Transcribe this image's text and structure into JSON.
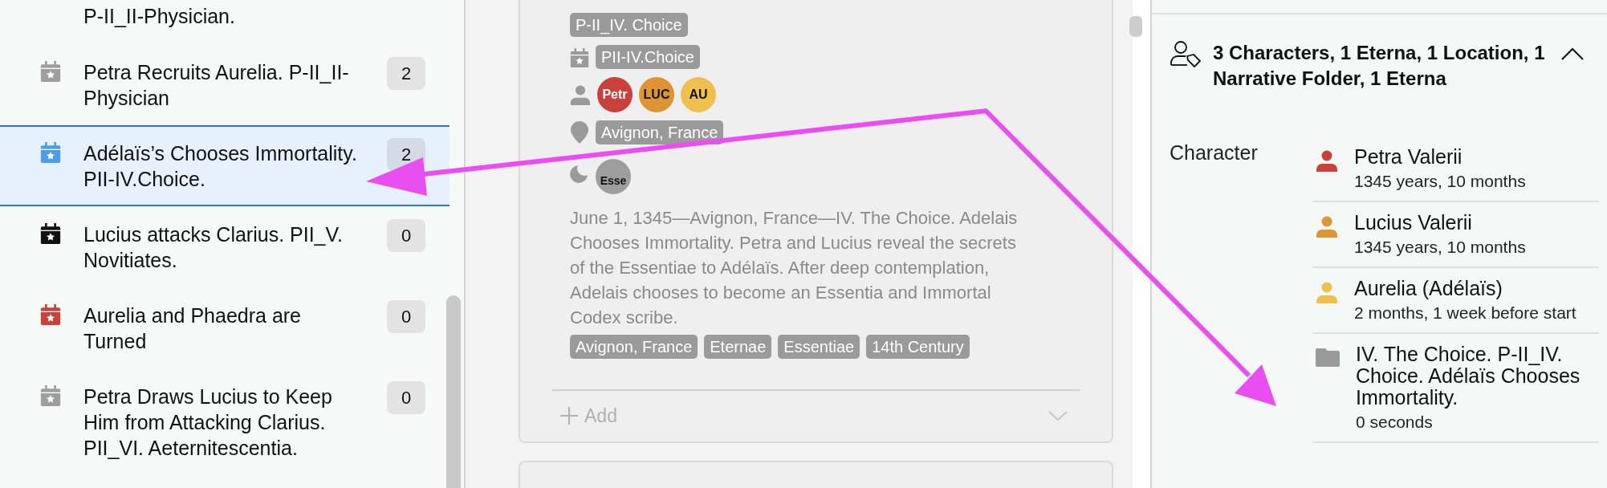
{
  "event_list": {
    "items": [
      {
        "title": "P-II_II-Physician.",
        "kind": "partial"
      },
      {
        "title": "Petra Recruits Aurelia. P-II_II-Physician",
        "count": "2",
        "color": "#9e9e9e",
        "selected": false,
        "kind": "event"
      },
      {
        "title": "Adélaïs’s Chooses Immortality. PII-IV.Choice.",
        "count": "2",
        "color": "#4a9ee8",
        "selected": true,
        "kind": "event"
      },
      {
        "title": "Lucius attacks Clarius. PII_V. Novitiates.",
        "count": "0",
        "color": "#111111",
        "selected": false,
        "kind": "event"
      },
      {
        "title": "Aurelia and Phaedra are Turned",
        "count": "0",
        "color": "#c9413a",
        "selected": false,
        "kind": "event"
      },
      {
        "title": "Petra Draws Lucius to Keep Him from Attacking Clarius. PII_VI. Aeternitescentia.",
        "count": "0",
        "color": "#9e9e9e",
        "selected": false,
        "kind": "event"
      }
    ]
  },
  "event_card": {
    "folder_tag": "P-II_IV. Choice",
    "event_tag": "PII-IV.Choice",
    "characters": [
      {
        "initials": "Petr",
        "color": "#c9413a"
      },
      {
        "initials": "LUC",
        "color": "#dd9432"
      },
      {
        "initials": "AU",
        "color": "#f0c04e"
      }
    ],
    "location_tag": "Avignon, France",
    "eternas": [
      {
        "initials": "Esse",
        "color": "#9e9e9e"
      }
    ],
    "description": "June 1, 1345—Avignon, France—IV. The Choice. Adelais Chooses Immortality. Petra and Lucius reveal the secrets of the Essentiae to Adélaïs. After deep contemplation, Adelais chooses to become an Essentia and Immortal Codex scribe.",
    "tags": [
      "Avignon, France",
      "Eternae",
      "Essentiae",
      "14th Century"
    ],
    "add_label": "Add"
  },
  "inspector": {
    "summary": "3 Characters, 1 Eterna, 1 Location, 1 Narrative Folder, 1 Eterna",
    "expanded": true,
    "sections": [
      {
        "label": "Character",
        "items": [
          {
            "kind": "character",
            "name": "Petra Valerii",
            "detail": "1345 years, 10 months",
            "color": "#c9413a"
          },
          {
            "kind": "character",
            "name": "Lucius Valerii",
            "detail": "1345 years, 10 months",
            "color": "#dd9432"
          },
          {
            "kind": "character",
            "name": "Aurelia (Adélaïs)",
            "detail": "2 months, 1 week before start",
            "color": "#f0c04e"
          },
          {
            "kind": "folder",
            "name": "IV. The Choice. P-II_IV. Choice. Adélaïs Chooses Immortality.",
            "detail": "0 seconds"
          }
        ]
      }
    ]
  }
}
